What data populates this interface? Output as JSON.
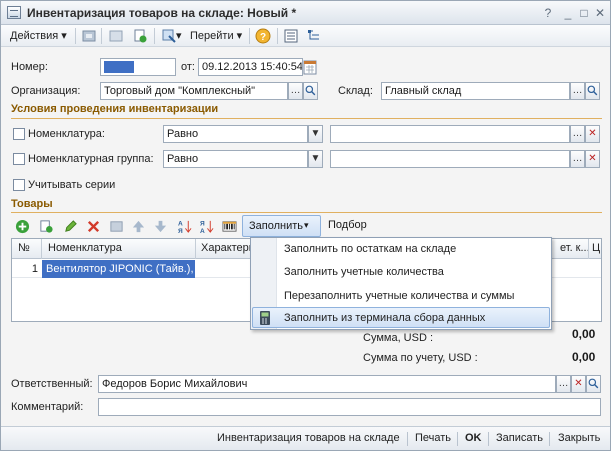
{
  "window": {
    "title": "Инвентаризация товаров на складе: Новый *"
  },
  "toolbar": {
    "actions": "Действия",
    "go": "Перейти"
  },
  "header": {
    "number_label": "Номер:",
    "date_label": "от:",
    "date_value": "09.12.2013 15:40:54",
    "org_label": "Организация:",
    "org_value": "Торговый дом \"Комплексный\"",
    "warehouse_label": "Склад:",
    "warehouse_value": "Главный склад"
  },
  "conditions": {
    "title": "Условия проведения инвентаризации",
    "rows": [
      {
        "label": "Номенклатура:",
        "operator": "Равно",
        "value": ""
      },
      {
        "label": "Номенклатурная группа:",
        "operator": "Равно",
        "value": ""
      }
    ],
    "series_label": "Учитывать серии"
  },
  "goods": {
    "title": "Товары",
    "fill_button": "Заполнить",
    "select_button": "Подбор",
    "columns": {
      "no": "№",
      "item": "Номенклатура",
      "char": "Характери",
      "unit": "ет. к...",
      "last": "Ц"
    },
    "rows": [
      {
        "no": "1",
        "item": "Вентилятор JIPONIC (Тайв.),"
      }
    ]
  },
  "fill_menu": {
    "items": [
      "Заполнить по остаткам на складе",
      "Заполнить учетные количества",
      "Перезаполнить учетные количества и суммы",
      "Заполнить из терминала сбора данных"
    ]
  },
  "totals": {
    "sum_label": "Сумма, USD :",
    "sum_value": "0,00",
    "acc_label": "Сумма по учету, USD :",
    "acc_value": "0,00"
  },
  "footer": {
    "responsible_label": "Ответственный:",
    "responsible_value": "Федоров Борис Михайлович",
    "comment_label": "Комментарий:",
    "comment_value": ""
  },
  "bottom": {
    "doc_link": "Инвентаризация товаров на складе",
    "print": "Печать",
    "ok": "OK",
    "save": "Записать",
    "close": "Закрыть"
  }
}
